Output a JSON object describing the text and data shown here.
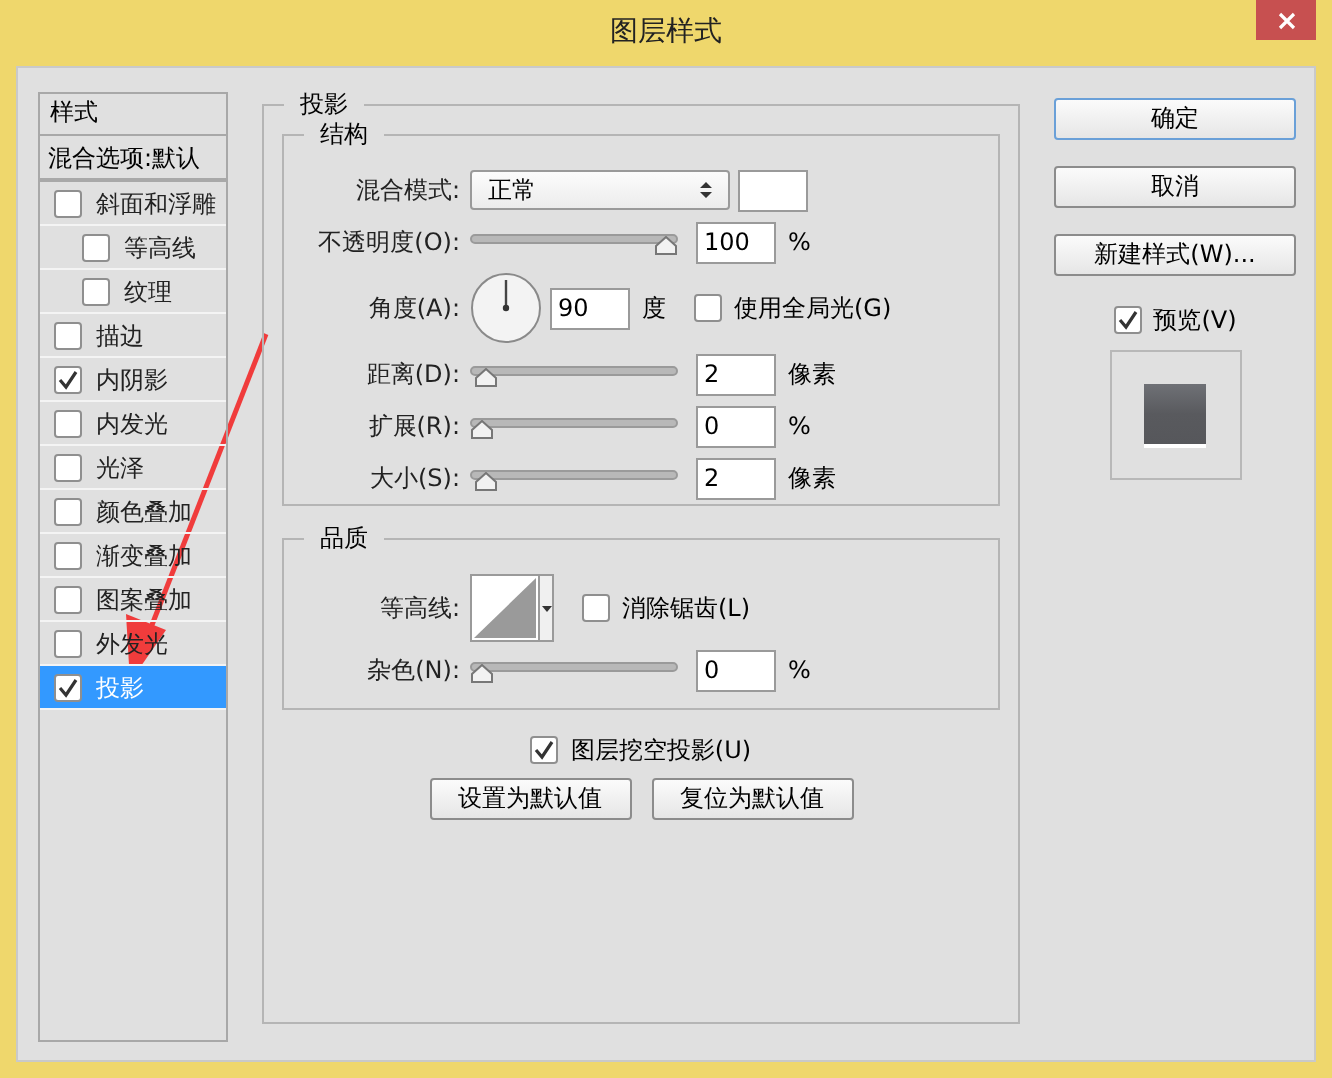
{
  "window": {
    "title": "图层样式"
  },
  "styles_panel": {
    "header": "样式",
    "blend_options": "混合选项:默认",
    "items": [
      {
        "label": "斜面和浮雕",
        "checked": false,
        "selected": false,
        "children": [
          {
            "label": "等高线",
            "checked": false,
            "selected": false
          },
          {
            "label": "纹理",
            "checked": false,
            "selected": false
          }
        ]
      },
      {
        "label": "描边",
        "checked": false,
        "selected": false
      },
      {
        "label": "内阴影",
        "checked": true,
        "selected": false
      },
      {
        "label": "内发光",
        "checked": false,
        "selected": false
      },
      {
        "label": "光泽",
        "checked": false,
        "selected": false
      },
      {
        "label": "颜色叠加",
        "checked": false,
        "selected": false
      },
      {
        "label": "渐变叠加",
        "checked": false,
        "selected": false
      },
      {
        "label": "图案叠加",
        "checked": false,
        "selected": false
      },
      {
        "label": "外发光",
        "checked": false,
        "selected": false
      },
      {
        "label": "投影",
        "checked": true,
        "selected": true
      }
    ]
  },
  "drop_shadow": {
    "title": "投影",
    "structure": {
      "title": "结构",
      "blend_mode": {
        "label": "混合模式:",
        "value": "正常"
      },
      "opacity": {
        "label": "不透明度(O):",
        "level": 1,
        "value": "100",
        "unit": "%"
      },
      "angle": {
        "label": "角度(A):",
        "value": "90",
        "unit": "度"
      },
      "use_global_light": {
        "label": "使用全局光(G)",
        "checked": false
      },
      "sliders": [
        {
          "label": "距离(D):",
          "level": 0.02,
          "value": "2",
          "unit": "像素"
        },
        {
          "label": "扩展(R):",
          "level": 0,
          "value": "0",
          "unit": "%"
        },
        {
          "label": "大小(S):",
          "level": 0.02,
          "value": "2",
          "unit": "像素"
        }
      ]
    },
    "quality": {
      "title": "品质",
      "contour_label": "等高线:",
      "anti_alias": {
        "label": "消除锯齿(L)",
        "checked": false
      },
      "noise": {
        "label": "杂色(N):",
        "level": 0,
        "value": "0",
        "unit": "%"
      }
    },
    "knockout": {
      "label": "图层挖空投影(U)",
      "checked": true
    },
    "buttons": [
      "设置为默认值",
      "复位为默认值"
    ]
  },
  "side_buttons": [
    "确定",
    "取消",
    "新建样式(W)..."
  ],
  "preview": {
    "label": "预览(V)",
    "checked": true
  }
}
